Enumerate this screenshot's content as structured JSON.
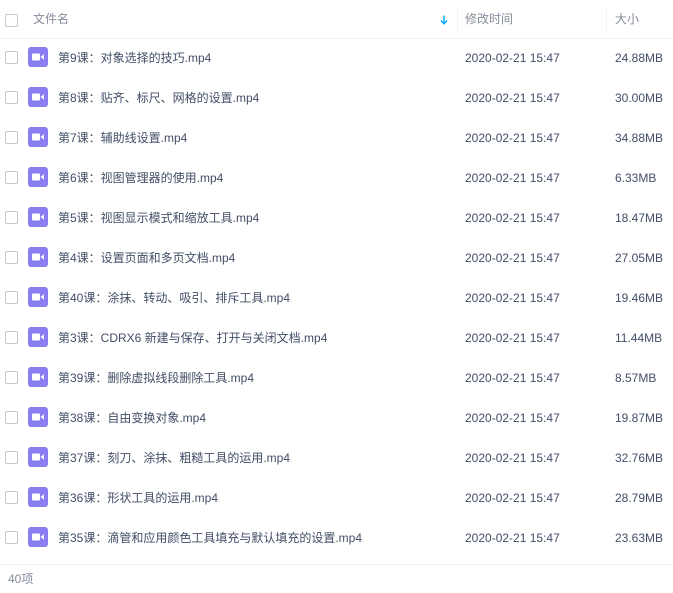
{
  "header": {
    "name_label": "文件名",
    "time_label": "修改时间",
    "size_label": "大小"
  },
  "files": [
    {
      "name": "第9课：对象选择的技巧.mp4",
      "modified": "2020-02-21 15:47",
      "size": "24.88MB"
    },
    {
      "name": "第8课：贴齐、标尺、网格的设置.mp4",
      "modified": "2020-02-21 15:47",
      "size": "30.00MB"
    },
    {
      "name": "第7课：辅助线设置.mp4",
      "modified": "2020-02-21 15:47",
      "size": "34.88MB"
    },
    {
      "name": "第6课：视图管理器的使用.mp4",
      "modified": "2020-02-21 15:47",
      "size": "6.33MB"
    },
    {
      "name": "第5课：视图显示模式和缩放工具.mp4",
      "modified": "2020-02-21 15:47",
      "size": "18.47MB"
    },
    {
      "name": "第4课：设置页面和多页文档.mp4",
      "modified": "2020-02-21 15:47",
      "size": "27.05MB"
    },
    {
      "name": "第40课：涂抹、转动、吸引、排斥工具.mp4",
      "modified": "2020-02-21 15:47",
      "size": "19.46MB"
    },
    {
      "name": "第3课：CDRX6 新建与保存、打开与关闭文档.mp4",
      "modified": "2020-02-21 15:47",
      "size": "11.44MB"
    },
    {
      "name": "第39课：删除虚拟线段删除工具.mp4",
      "modified": "2020-02-21 15:47",
      "size": "8.57MB"
    },
    {
      "name": "第38课：自由变换对象.mp4",
      "modified": "2020-02-21 15:47",
      "size": "19.87MB"
    },
    {
      "name": "第37课：刻刀、涂抹、粗糙工具的运用.mp4",
      "modified": "2020-02-21 15:47",
      "size": "32.76MB"
    },
    {
      "name": "第36课：形状工具的运用.mp4",
      "modified": "2020-02-21 15:47",
      "size": "28.79MB"
    },
    {
      "name": "第35课：滴管和应用颜色工具填充与默认填充的设置.mp4",
      "modified": "2020-02-21 15:47",
      "size": "23.63MB"
    }
  ],
  "footer": {
    "count": "40项"
  },
  "colors": {
    "video_icon": "#8a7ef0",
    "sort_arrow": "#06a7ff"
  },
  "icons": {
    "file": "video-file-icon",
    "sort": "sort-down-arrow-icon"
  }
}
